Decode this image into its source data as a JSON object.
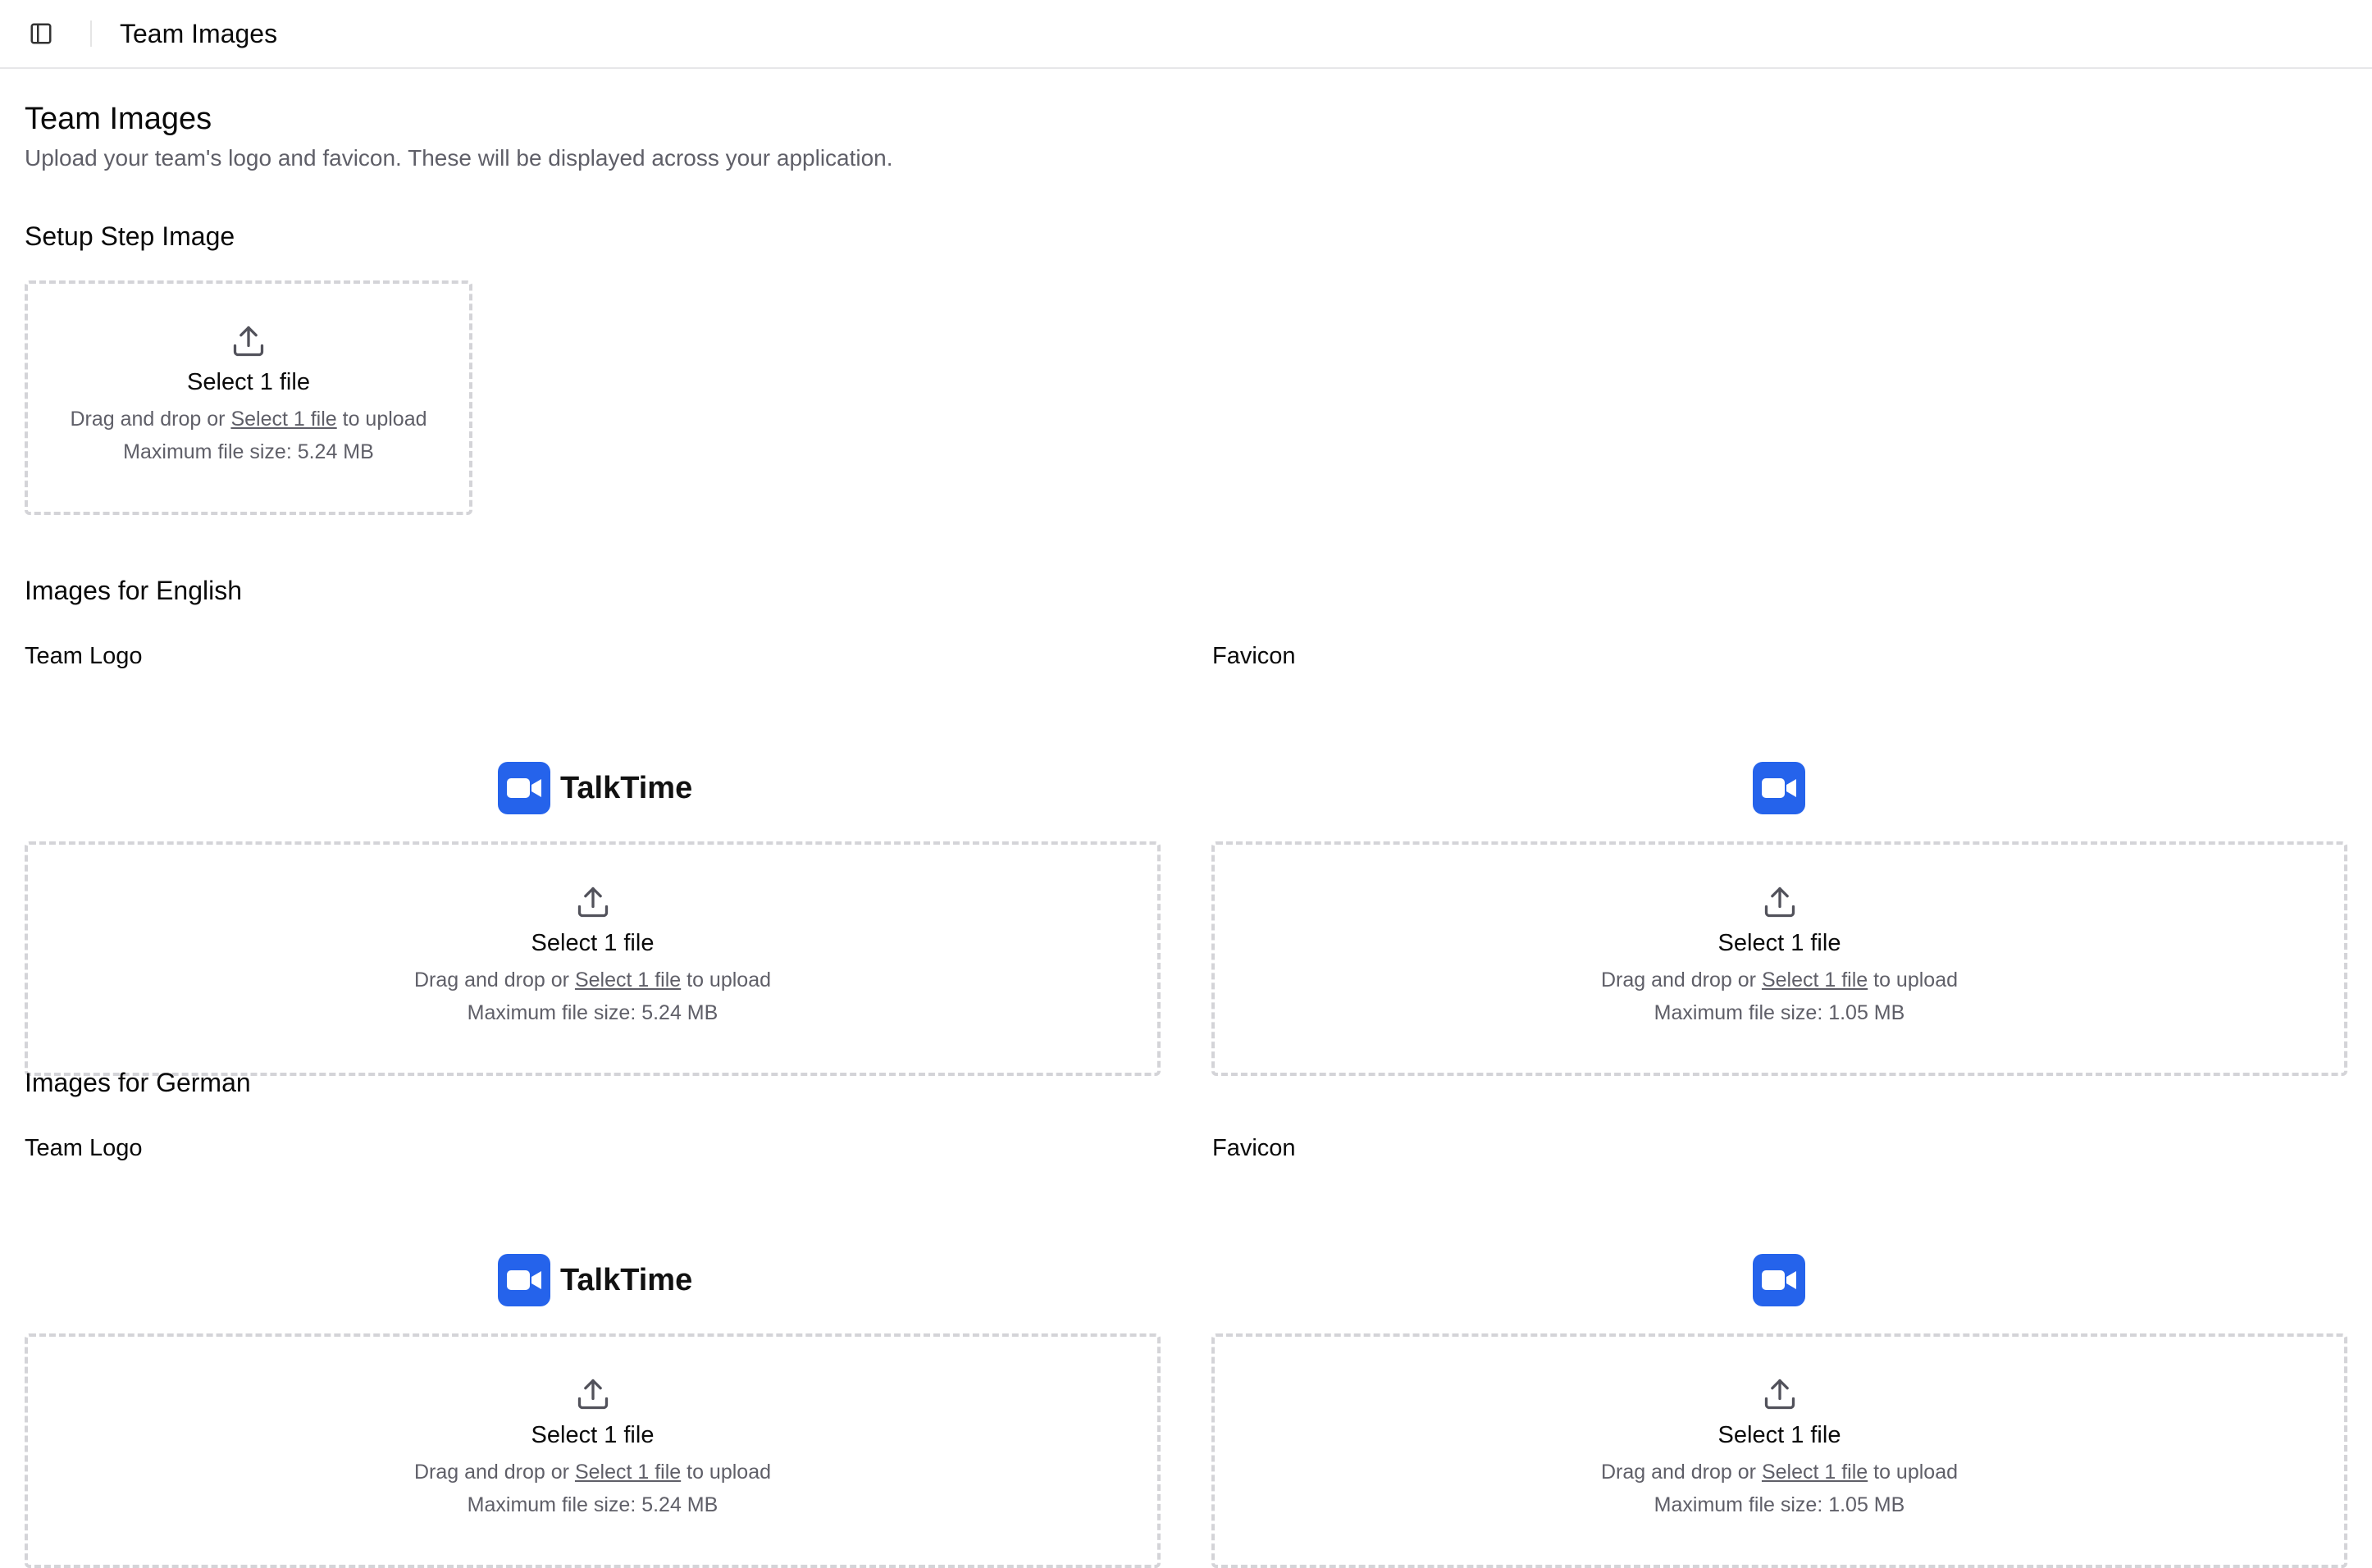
{
  "header": {
    "title": "Team Images",
    "toggle_icon": "sidebar-toggle-icon"
  },
  "page": {
    "title": "Team Images",
    "subtitle": "Upload your team's logo and favicon. These will be displayed across your application."
  },
  "setup": {
    "title": "Setup Step Image",
    "dropzone": {
      "title": "Select 1 file",
      "drag_prefix": "Drag and drop or ",
      "link": "Select 1 file",
      "drag_suffix": " to upload",
      "max_size": "Maximum file size: 5.24 MB"
    }
  },
  "english": {
    "title": "Images for English",
    "logo": {
      "label": "Team Logo",
      "brand": "TalkTime",
      "dropzone": {
        "title": "Select 1 file",
        "drag_prefix": "Drag and drop or ",
        "link": "Select 1 file",
        "drag_suffix": " to upload",
        "max_size": "Maximum file size: 5.24 MB"
      }
    },
    "favicon": {
      "label": "Favicon",
      "dropzone": {
        "title": "Select 1 file",
        "drag_prefix": "Drag and drop or ",
        "link": "Select 1 file",
        "drag_suffix": " to upload",
        "max_size": "Maximum file size: 1.05 MB"
      }
    }
  },
  "german": {
    "title": "Images for German",
    "logo": {
      "label": "Team Logo",
      "brand": "TalkTime",
      "dropzone": {
        "title": "Select 1 file",
        "drag_prefix": "Drag and drop or ",
        "link": "Select 1 file",
        "drag_suffix": " to upload",
        "max_size": "Maximum file size: 5.24 MB"
      }
    },
    "favicon": {
      "label": "Favicon",
      "dropzone": {
        "title": "Select 1 file",
        "drag_prefix": "Drag and drop or ",
        "link": "Select 1 file",
        "drag_suffix": " to upload",
        "max_size": "Maximum file size: 1.05 MB"
      }
    }
  },
  "colors": {
    "brand": "#2563eb",
    "muted_text": "#5f5f68",
    "dash_border": "#d4d4d8"
  }
}
